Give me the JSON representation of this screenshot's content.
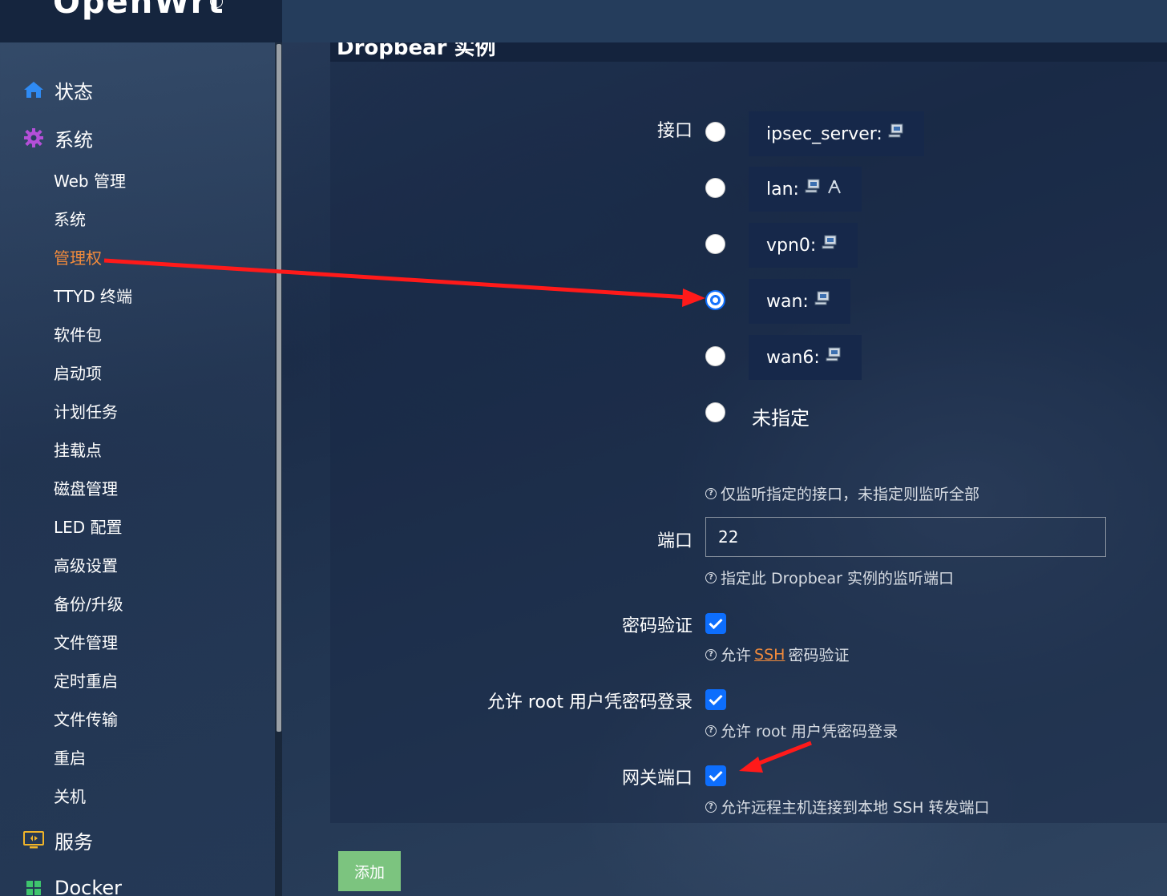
{
  "brand": {
    "name": "OpenWrt"
  },
  "sidebar": {
    "top_items": [
      {
        "label": "状态",
        "icon": "home-icon"
      },
      {
        "label": "系统",
        "icon": "gear-icon"
      },
      {
        "label": "服务",
        "icon": "services-icon"
      },
      {
        "label": "Docker",
        "icon": "docker-icon"
      }
    ],
    "sub_items": [
      {
        "label": "Web 管理"
      },
      {
        "label": "系统"
      },
      {
        "label": "管理权",
        "active": true
      },
      {
        "label": "TTYD 终端"
      },
      {
        "label": "软件包"
      },
      {
        "label": "启动项"
      },
      {
        "label": "计划任务"
      },
      {
        "label": "挂载点"
      },
      {
        "label": "磁盘管理"
      },
      {
        "label": "LED 配置"
      },
      {
        "label": "高级设置"
      },
      {
        "label": "备份/升级"
      },
      {
        "label": "文件管理"
      },
      {
        "label": "定时重启"
      },
      {
        "label": "文件传输"
      },
      {
        "label": "重启"
      },
      {
        "label": "关机"
      }
    ]
  },
  "panel": {
    "title": "Dropbear 实例",
    "interface": {
      "label": "接口",
      "options": [
        {
          "name": "ipsec_server:",
          "icons": [
            "network-icon"
          ]
        },
        {
          "name": "lan:",
          "icons": [
            "network-icon",
            "wireless-icon"
          ]
        },
        {
          "name": "vpn0:",
          "icons": [
            "network-icon"
          ]
        },
        {
          "name": "wan:",
          "icons": [
            "network-icon"
          ],
          "selected": true
        },
        {
          "name": "wan6:",
          "icons": [
            "network-icon"
          ]
        }
      ],
      "unspecified": "未指定",
      "help": "仅监听指定的接口，未指定则监听全部"
    },
    "port": {
      "label": "端口",
      "value": "22",
      "help": "指定此 Dropbear 实例的监听端口"
    },
    "password_auth": {
      "label": "密码验证",
      "checked": true,
      "help_prefix": "允许",
      "help_link": "SSH",
      "help_suffix": "密码验证"
    },
    "root_password_login": {
      "label": "允许 root 用户凭密码登录",
      "checked": true,
      "help": "允许 root 用户凭密码登录"
    },
    "gateway_ports": {
      "label": "网关端口",
      "checked": true,
      "help": "允许远程主机连接到本地 SSH 转发端口"
    },
    "add_button": "添加"
  },
  "colors": {
    "accent": "#0d6efd",
    "active_menu": "#f08a3c",
    "add_button": "#7cc47f",
    "annotation_arrow": "#ff1a1a"
  }
}
